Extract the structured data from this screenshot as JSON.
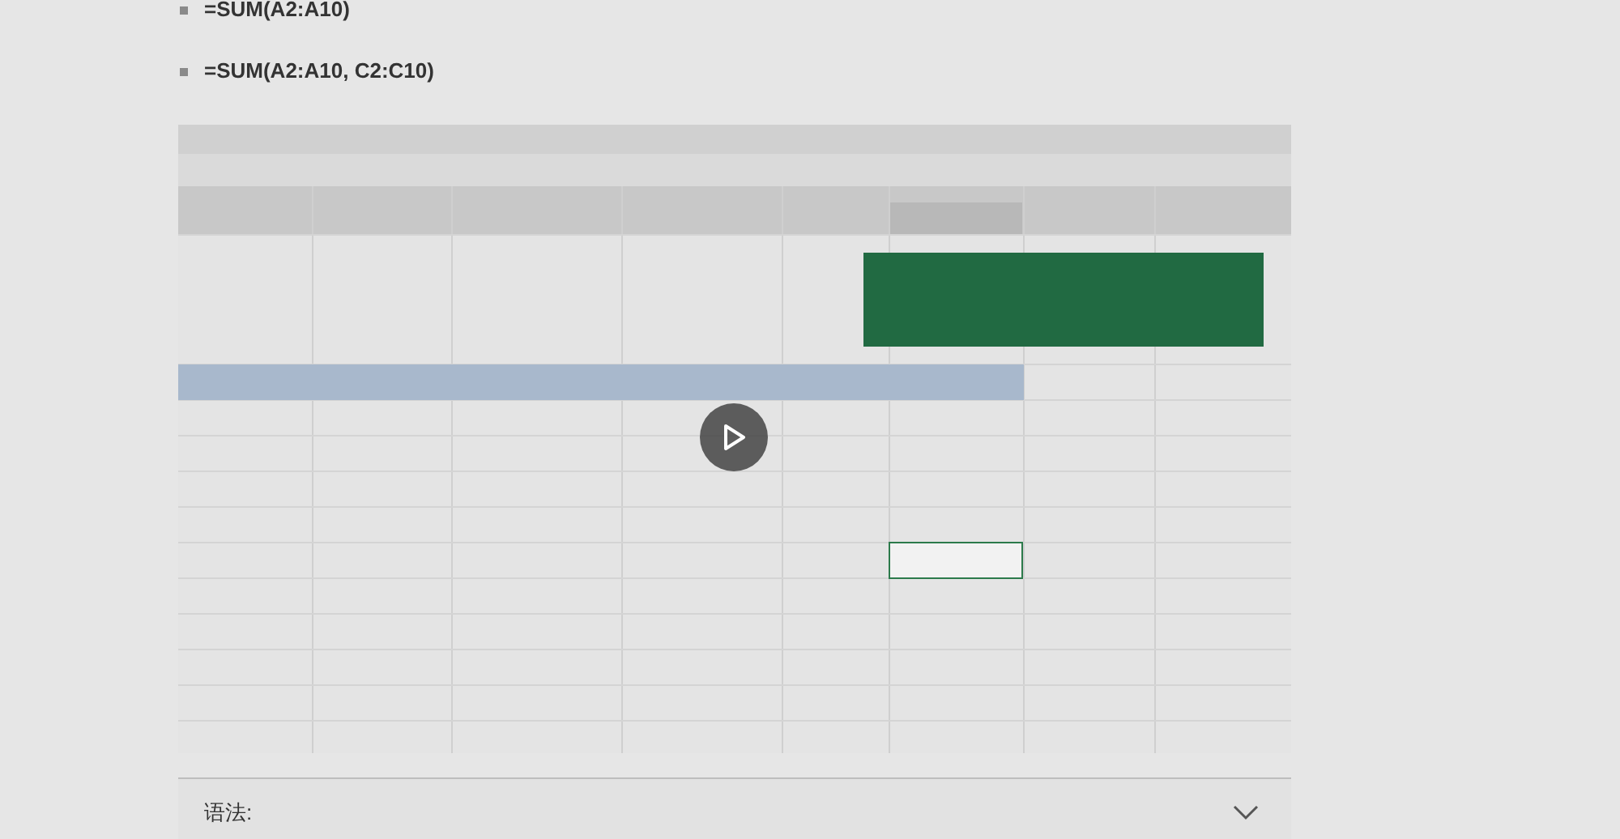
{
  "formulas": [
    "=SUM(A2:A10)",
    "=SUM(A2:A10, C2:C10)"
  ],
  "syntax_section": {
    "label": "语法:",
    "expanded": false
  }
}
